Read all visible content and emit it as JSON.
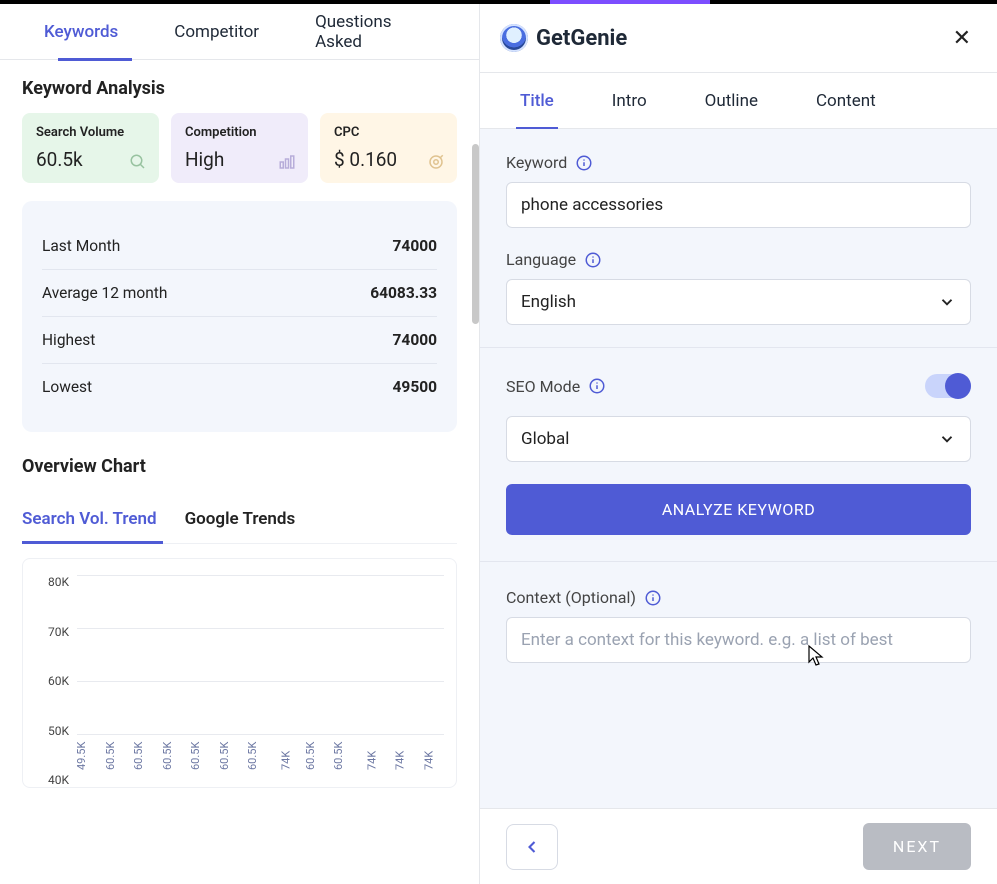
{
  "brand": "GetGenie",
  "left_tabs": [
    "Keywords",
    "Competitor",
    "Questions Asked"
  ],
  "left_tabs_active": 0,
  "section_title": "Keyword Analysis",
  "kpi": {
    "sv_label": "Search Volume",
    "sv_value": "60.5k",
    "comp_label": "Competition",
    "comp_value": "High",
    "cpc_label": "CPC",
    "cpc_value": "$ 0.160"
  },
  "stats": [
    {
      "label": "Last Month",
      "value": "74000"
    },
    {
      "label": "Average 12 month",
      "value": "64083.33"
    },
    {
      "label": "Highest",
      "value": "74000"
    },
    {
      "label": "Lowest",
      "value": "49500"
    }
  ],
  "overview_title": "Overview Chart",
  "subtabs": [
    "Search Vol. Trend",
    "Google Trends"
  ],
  "subtabs_active": 0,
  "chart_data": {
    "type": "bar",
    "y_ticks": [
      "80K",
      "70K",
      "60K",
      "50K",
      "40K"
    ],
    "ylim": [
      40000,
      80000
    ],
    "series_label": "Search Volume",
    "values": [
      49500,
      60500,
      60500,
      60500,
      60500,
      60500,
      60500,
      74000,
      60500,
      60500,
      74000,
      74000,
      74000
    ],
    "value_labels": [
      "49.5K",
      "60.5K",
      "60.5K",
      "60.5K",
      "60.5K",
      "60.5K",
      "60.5K",
      "74K",
      "60.5K",
      "60.5K",
      "74K",
      "74K",
      "74K"
    ]
  },
  "right_tabs": [
    "Title",
    "Intro",
    "Outline",
    "Content"
  ],
  "right_tabs_active": 0,
  "form": {
    "keyword_label": "Keyword",
    "keyword_value": "phone accessories",
    "language_label": "Language",
    "language_value": "English",
    "seo_label": "SEO Mode",
    "seo_on": true,
    "region_value": "Global",
    "analyze_btn": "ANALYZE KEYWORD",
    "context_label": "Context (Optional)",
    "context_placeholder": "Enter a context for this keyword. e.g. a list of best"
  },
  "footer": {
    "next": "NEXT"
  }
}
